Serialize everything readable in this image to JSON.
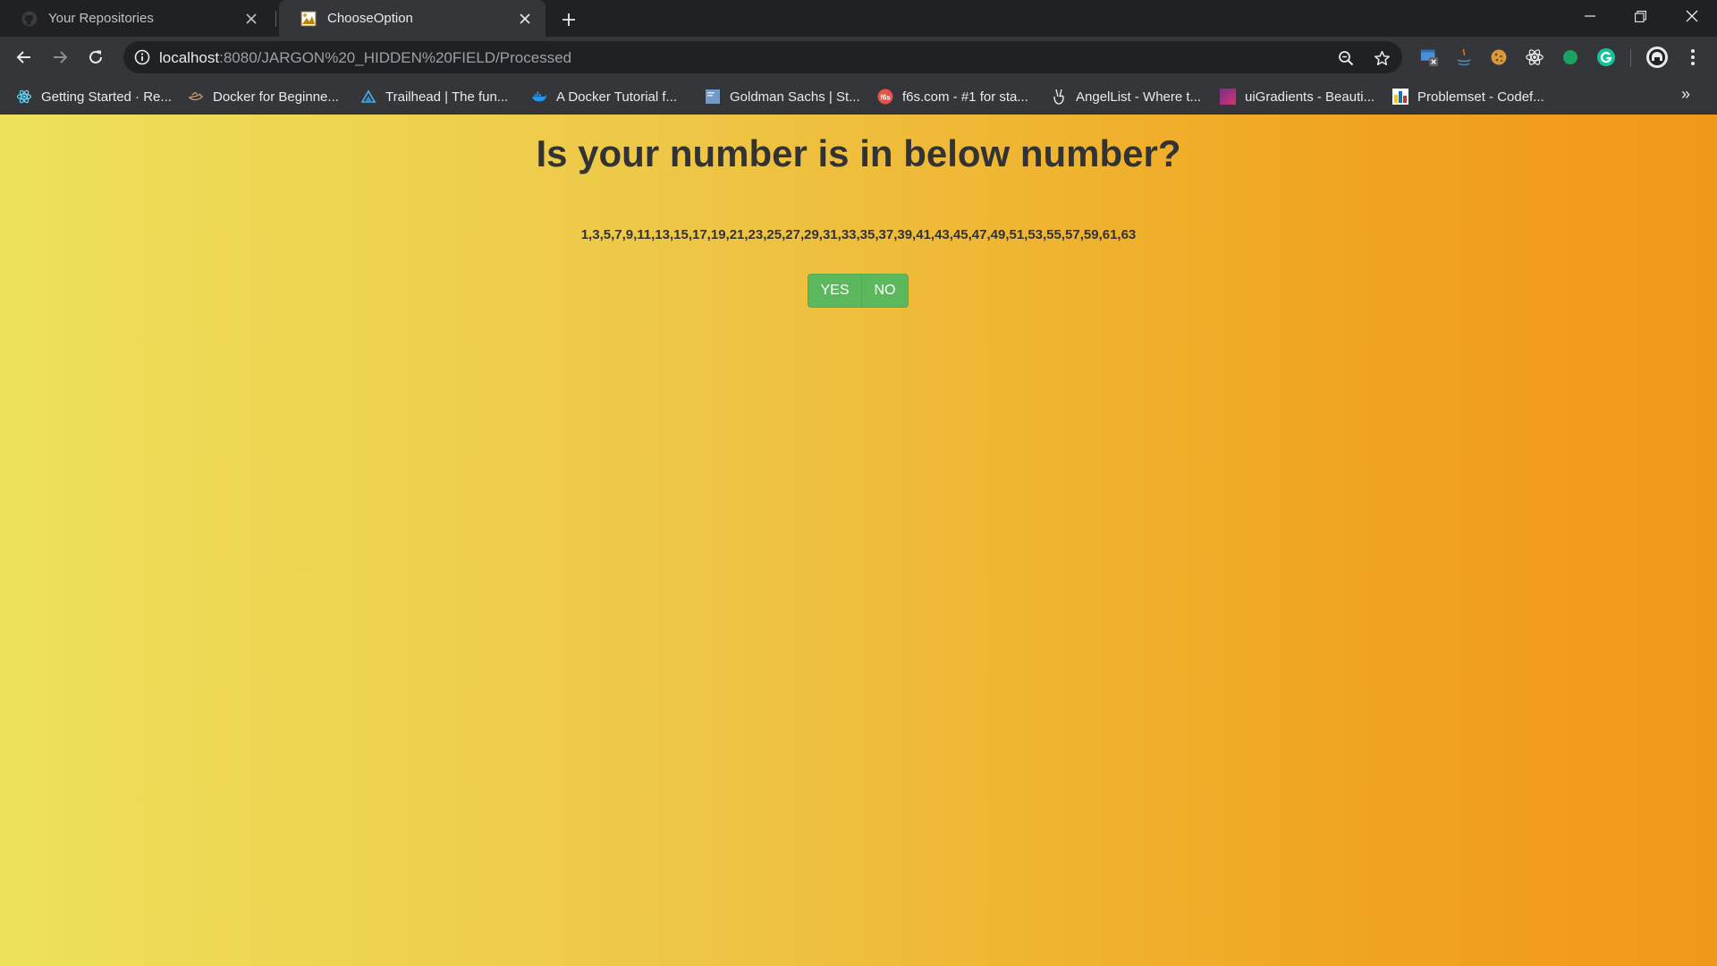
{
  "browser": {
    "tabs": [
      {
        "title": "Your Repositories",
        "active": false,
        "icon": "github-icon"
      },
      {
        "title": "ChooseOption",
        "active": true,
        "icon": "page-favicon-icon"
      }
    ],
    "address": {
      "host": "localhost",
      "path": ":8080/JARGON%20_HIDDEN%20FIELD/Processed"
    },
    "bookmarks": [
      {
        "label": "Getting Started · Re...",
        "icon": "react-icon"
      },
      {
        "label": "Docker for Beginne...",
        "icon": "docker-icon"
      },
      {
        "label": "Trailhead | The fun...",
        "icon": "trailhead-icon"
      },
      {
        "label": "A Docker Tutorial f...",
        "icon": "docker-whale-icon"
      },
      {
        "label": "Goldman Sachs | St...",
        "icon": "goldman-sachs-icon"
      },
      {
        "label": "f6s.com - #1 for sta...",
        "icon": "f6s-icon"
      },
      {
        "label": "AngelList - Where t...",
        "icon": "angellist-icon"
      },
      {
        "label": "uiGradients - Beauti...",
        "icon": "uigradients-icon"
      },
      {
        "label": "Problemset - Codef...",
        "icon": "codeforces-icon"
      }
    ],
    "bookmarks_more": "»"
  },
  "page": {
    "heading": "Is your number is in below number?",
    "numbers": "1,3,5,7,9,11,13,15,17,19,21,23,25,27,29,31,33,35,37,39,41,43,45,47,49,51,53,55,57,59,61,63",
    "yes_label": "YES",
    "no_label": "NO",
    "button_color": "#5cb85c",
    "gradient": [
      "#ede15b",
      "#f09819"
    ]
  }
}
